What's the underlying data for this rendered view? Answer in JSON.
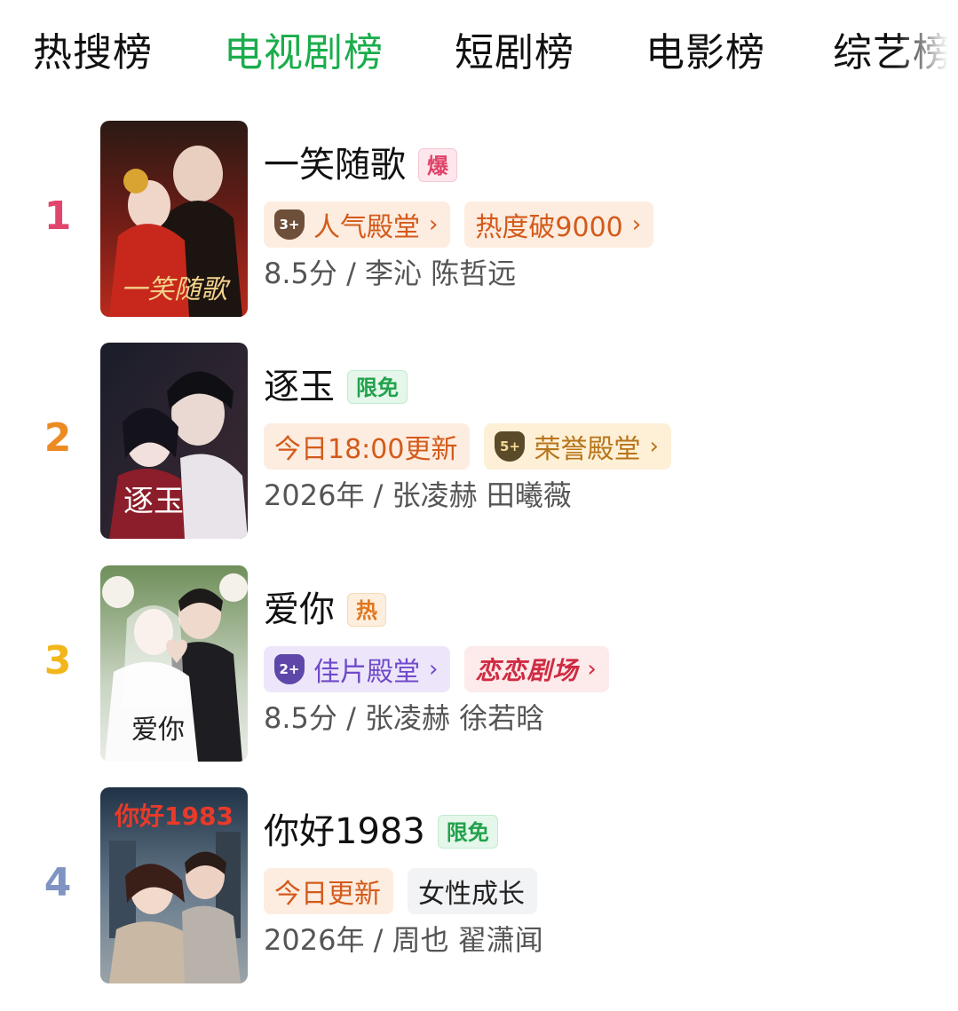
{
  "tabs": [
    {
      "label": "热搜榜",
      "active": false
    },
    {
      "label": "电视剧榜",
      "active": true
    },
    {
      "label": "短剧榜",
      "active": false
    },
    {
      "label": "电影榜",
      "active": false
    },
    {
      "label": "综艺榜",
      "active": false
    }
  ],
  "accent_color": "#1aad4b",
  "items": [
    {
      "rank": "1",
      "rank_color": "#e2456c",
      "title": "一笑随歌",
      "badge": "爆",
      "tags": [
        {
          "text": "人气殿堂",
          "icon": "trophy-shield-icon",
          "icon_text": "3+",
          "chevron": "›",
          "style": "orange"
        },
        {
          "text": "热度破9000",
          "chevron": "›",
          "style": "orange"
        }
      ],
      "meta": "8.5分 / 李沁 陈哲远",
      "poster_text": "一笑随歌"
    },
    {
      "rank": "2",
      "rank_color": "#ec8a24",
      "title": "逐玉",
      "badge": "限免",
      "tags": [
        {
          "text": "今日18:00更新",
          "style": "orange"
        },
        {
          "text": "荣誉殿堂",
          "icon": "trophy-shield-icon",
          "icon_text": "5+",
          "chevron": "›",
          "style": "gold"
        }
      ],
      "meta": "2026年 / 张凌赫 田曦薇",
      "poster_text": "逐玉"
    },
    {
      "rank": "3",
      "rank_color": "#f2b61a",
      "title": "爱你",
      "badge": "热",
      "tags": [
        {
          "text": "佳片殿堂",
          "icon": "trophy-shield-icon",
          "icon_text": "2+",
          "chevron": "›",
          "style": "purple"
        },
        {
          "text": "恋恋剧场",
          "chevron": "›",
          "style": "pink"
        }
      ],
      "meta": "8.5分 / 张凌赫 徐若晗",
      "poster_text": "爱你"
    },
    {
      "rank": "4",
      "rank_color": "#7f94c2",
      "title": "你好1983",
      "badge": "限免",
      "tags": [
        {
          "text": "今日更新",
          "style": "orange"
        },
        {
          "text": "女性成长",
          "style": "grey"
        }
      ],
      "meta": "2026年 / 周也 翟潇闻",
      "poster_text": "你好1983"
    }
  ]
}
